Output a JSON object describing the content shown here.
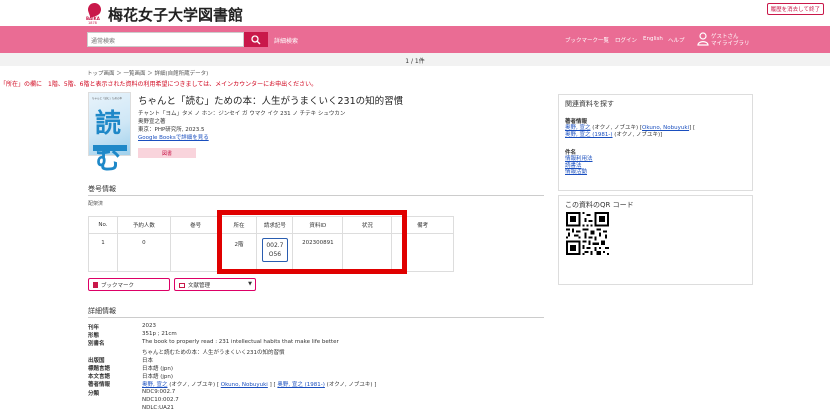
{
  "header": {
    "site_title": "梅花女子大学図書館",
    "logo_text": "BAIKA",
    "logo_year": "1878",
    "close_button": "履歴を消去して終了"
  },
  "navbar": {
    "search_placeholder": "通常検索",
    "advanced_search": "詳細検索",
    "links": [
      "ブックマーク一覧",
      "ログイン",
      "English",
      "ヘルプ"
    ],
    "user_name": "ゲストさん",
    "my_library": "マイライブラリ"
  },
  "pager": {
    "text": "1 / 1件"
  },
  "breadcrumb": "トップ画面 ＞ 一覧画面 ＞ 詳細(自館所蔵データ)",
  "alert": "「所在」の欄に　1階、5階、6階と表示された資料の利用希望につきましては、メインカウンターにお申出ください。",
  "book": {
    "title": "ちゃんと「読む」ための本：人生がうまくいく231の知的習慣",
    "kana": "チャント「ヨム」タメ ノ ホン：ジンセイ ガ ウマク イク 231 ノ チテキ シュウカン",
    "author": "奥野宣之著",
    "publisher": "東京：PHP研究所, 2023.5",
    "google_books": "Google Booksで詳細を見る",
    "badge": "図書",
    "cover_big": "読む",
    "cover_small": "ちゃんと「読む」ための本"
  },
  "holdings": {
    "heading": "巻号情報",
    "note": "配架済",
    "columns": [
      "No.",
      "予約人数",
      "巻号",
      "所在",
      "請求記号",
      "資料ID",
      "状況",
      "備考"
    ],
    "rows": [
      {
        "no": "1",
        "reserve": "0",
        "volume": "",
        "location": "2階",
        "callno_1": "002.7",
        "callno_2": "O56",
        "id": "202300891",
        "status": "",
        "remarks": ""
      }
    ]
  },
  "actions": {
    "bookmark": "ブックマーク",
    "doc_manage": "文献管理"
  },
  "detail": {
    "heading": "詳細情報",
    "rows": [
      {
        "k": "刊年",
        "v": "2023"
      },
      {
        "k": "形態",
        "v": "351p ; 21cm"
      },
      {
        "k": "別書名",
        "v": "The book to properly read : 231 intellectual habits that make life better"
      },
      {
        "k": "",
        "v": "ちゃんと読むための本：人生がうまくいく231の知的習慣"
      },
      {
        "k": "出版国",
        "v": "日本"
      },
      {
        "k": "標題言語",
        "v": "日本語 (jpn)"
      },
      {
        "k": "本文言語",
        "v": "日本語 (jpn)"
      },
      {
        "k": "著者情報",
        "v_link1": "奥野, 宣之",
        "v_mid1": " (オクノ, ノブユキ) [ ",
        "v_link2": "Okuno, Nobuyuki",
        "v_mid2": " ] [ ",
        "v_link3": "奥野, 宣之 (1981-)",
        "v_end": " (オクノ, ノブユキ) ]"
      },
      {
        "k": "分類",
        "v": "NDC9:002.7"
      },
      {
        "k": "",
        "v": "NDC10:002.7"
      },
      {
        "k": "",
        "v": "NDLC:UA21"
      }
    ]
  },
  "sidebar": {
    "related_heading": "関連資料を探す",
    "author_heading": "著者情報",
    "author_links": [
      "奥野, 宣之",
      "Okuno, Nobuyuki",
      "奥野, 宣之 (1981-)"
    ],
    "author_txt1": " (オクノ, ノブユキ) [",
    "author_txt2": "] [",
    "author_txt3": " (オクノ, ノブユキ)]",
    "subject_heading": "件名",
    "subject_links": [
      "情報利用法",
      "読書法",
      "情報活動"
    ],
    "qr_heading": "この資料のQR コード"
  },
  "colors": {
    "accent": "#ea6c94",
    "brand": "#c9184a",
    "highlight": "#e00000"
  }
}
